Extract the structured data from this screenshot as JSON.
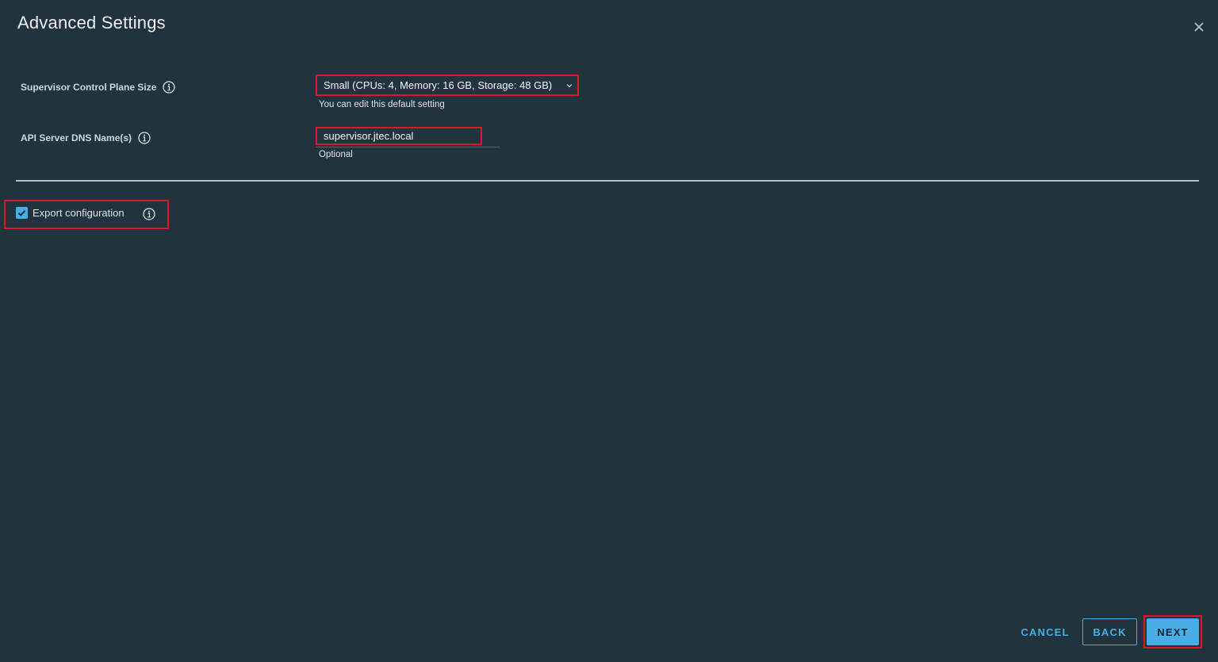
{
  "dialog": {
    "title": "Advanced Settings"
  },
  "fields": {
    "control_plane_size": {
      "label": "Supervisor Control Plane Size",
      "value": "Small (CPUs: 4, Memory: 16 GB, Storage: 48 GB)",
      "helper": "You can edit this default setting"
    },
    "api_dns": {
      "label": "API Server DNS Name(s)",
      "value": "supervisor.jtec.local",
      "helper": "Optional"
    }
  },
  "export": {
    "label": "Export configuration",
    "checked": true
  },
  "footer": {
    "cancel_label": "CANCEL",
    "back_label": "BACK",
    "next_label": "NEXT"
  },
  "colors": {
    "background": "#21333d",
    "accent": "#49aee6",
    "highlight": "#e0142a"
  }
}
